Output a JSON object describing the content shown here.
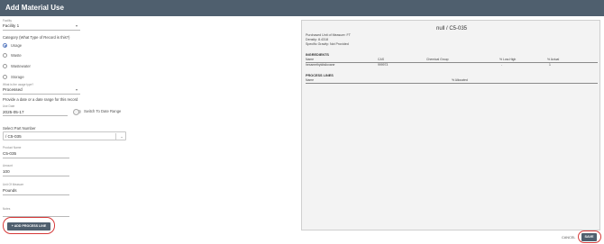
{
  "header": {
    "title": "Add Material Use"
  },
  "form": {
    "facility_label": "Facility",
    "facility_value": "Facility 1",
    "category_label": "Category (What Type of Record is this?)",
    "categories": [
      "Usage",
      "Waste",
      "Wastewater",
      "Storage"
    ],
    "selected_category": "Usage",
    "usage_type_label": "What is the usage type?",
    "usage_type_value": "Processed",
    "date_prompt": "Provide a date or a date range for this record",
    "date_label": "Use Date",
    "date_value": "2025-05-17",
    "switch_label": "Switch To Date Range",
    "part_label": "Select Part Number",
    "part_value": "/ C5-035",
    "product_label": "Product Name",
    "product_value": "C5-035",
    "amount_label": "Amount",
    "amount_value": "100",
    "unit_label": "Unit Of Measure",
    "unit_value": "Pounds",
    "notes_label": "Notes"
  },
  "buttons": {
    "add_process_line": "+ ADD PROCESS LINE",
    "cancel": "CANCEL",
    "save": "SAVE"
  },
  "panel": {
    "title": "null / C5-035",
    "purchased_uom": "Purchased Unit of Measure: FT",
    "density": "Density: 8.4318",
    "specific_gravity": "Specific Gravity: Not Provided",
    "ingredients_title": "INGREDIENTS",
    "ingredient_columns": [
      "Name",
      "CAS",
      "Chemical Group",
      "% Low-High",
      "% Actual"
    ],
    "ingredients": [
      {
        "name": "hexamethyldisiloxane",
        "cas": "999973",
        "group": "",
        "low_high": "-",
        "actual": "1"
      }
    ],
    "process_lines_title": "PROCESS LINES",
    "process_columns": [
      "Name",
      "% Allocated"
    ]
  },
  "colors": {
    "header": "#4f5f6e",
    "accent": "#5b7cc0",
    "highlight_ring": "#d63a3a"
  }
}
